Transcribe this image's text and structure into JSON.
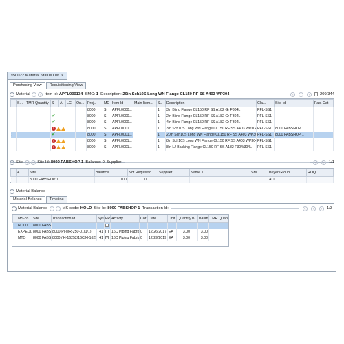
{
  "window": {
    "doc_tab": "s50022 Material Status List",
    "close": "×",
    "view_tabs": [
      "Purchasing View",
      "Requisitioning View"
    ]
  },
  "material": {
    "title": "Material",
    "item_id_label": "Item Id:",
    "item_id": "APFL000134",
    "smc_label": "SMC:",
    "smc": "1",
    "desc_label": "Description:",
    "desc": "20in Sch10S Long WN Flange CL150 RF SS A403 WP304",
    "count": "209/344",
    "columns": [
      "S.I.",
      "TMR Quantity",
      "S",
      "A",
      "LC",
      "On...",
      "Proj..",
      "MC",
      "Item Id",
      "Main Item...",
      "S..",
      "Description",
      "Cla...",
      "Site Id",
      "Fab. Cat"
    ],
    "rows": [
      {
        "tmr": "",
        "status": "",
        "proj": "8000",
        "mc": "S",
        "item": "APFL0000...",
        "main": "",
        "s": "1",
        "desc": "3in Blind Flange CL150 RF SS A182 Gr F304L",
        "cla": "PFL-SS1",
        "site": "",
        "fab": ""
      },
      {
        "tmr": "",
        "status": "check",
        "proj": "8000",
        "mc": "S",
        "item": "APFL0000...",
        "main": "",
        "s": "1",
        "desc": "2in Blind Flange CL150 RF SS A182 Gr F304L",
        "cla": "PFL-SS1",
        "site": "",
        "fab": ""
      },
      {
        "tmr": "",
        "status": "check",
        "proj": "8000",
        "mc": "S",
        "item": "APFL0000...",
        "main": "",
        "s": "1",
        "desc": "4in Blind Flange CL150 RF SS A182 Gr F304L",
        "cla": "PFL-SS1",
        "site": "",
        "fab": ""
      },
      {
        "tmr": "",
        "status": "stopwarn",
        "proj": "8000",
        "mc": "S",
        "item": "APFL0001...",
        "main": "",
        "s": "1",
        "desc": "3in Sch10S Long WN Flange CL150 RF SS A403 WP304",
        "cla": "PFL-SS1",
        "site": "8000 FABSHOP 1",
        "fab": ""
      },
      {
        "tmr": "",
        "status": "check",
        "proj": "8000",
        "mc": "S",
        "item": "APFL0001...",
        "main": "",
        "s": "1",
        "desc": "20in Sch10S Long WN Flange CL150 RF SS A403 WP304",
        "cla": "PFL-SS1",
        "site": "8000 FABSHOP 1",
        "fab": ""
      },
      {
        "tmr": "",
        "status": "stopwarn",
        "proj": "8000",
        "mc": "S",
        "item": "APFL0001...",
        "main": "",
        "s": "1",
        "desc": "8in Sch10S Long WN Flange CL150 RF SS A403 WP304",
        "cla": "PFL-SS1",
        "site": "",
        "fab": ""
      },
      {
        "tmr": "",
        "status": "stopwarn",
        "proj": "8000",
        "mc": "S",
        "item": "APFL0001...",
        "main": "",
        "s": "1",
        "desc": "8in LJ Backing Flange CL150 RF SS A182 F304/304L",
        "cla": "PFL-SS1",
        "site": "",
        "fab": ""
      }
    ]
  },
  "site": {
    "title": "Site",
    "site_id_label": "Site Id:",
    "site_id": "8000 FABSHOP 1",
    "balance_label": "Balance:",
    "balance": "0",
    "supplier_label": "Supplier:",
    "count": "1/1",
    "columns": [
      "A",
      "Site",
      "Balance",
      "Not Requisitio...",
      "Supplier",
      "Name 1",
      "SMC",
      "Buyer Group",
      "ROQ"
    ],
    "rows": [
      {
        "a": "",
        "site": "8000 FABSHOP 1",
        "balance": "0.00",
        "notreq": "0",
        "supplier": "",
        "name": "",
        "smc": "1",
        "buyer": "ALL",
        "roq": ""
      }
    ]
  },
  "mat_balance": {
    "title": "Material Balance",
    "sub_tabs": [
      "Material Balance",
      "Timeline"
    ],
    "inner_title": "Material Balance",
    "ms_code_label": "MS-code:",
    "ms_code": "HOLD",
    "site_id_label": "Site Id:",
    "site_id": "8000 FABSHOP 1",
    "trans_label": "Transaction Id:",
    "count": "1/3",
    "columns": [
      "MS-co...",
      "Site",
      "Transaction Id",
      "Sys..",
      "FR",
      "Activity",
      "Cor..",
      "Date",
      "Unit",
      "Quantity",
      "B...",
      "Balan...",
      "TMR Quantity"
    ],
    "rows": [
      {
        "ms": "HOLD",
        "site": "8000 FABS...",
        "trans": "",
        "sys": "",
        "fr": false,
        "act": "",
        "cor": "",
        "date": "",
        "unit": "",
        "qty": "",
        "b": "",
        "bal": "",
        "tmr": ""
      },
      {
        "ms": "EXPEDI...",
        "site": "8000 FABS...",
        "trans": "8000-PI-MR-250-01(1/1)",
        "sys": "41",
        "fr": false,
        "act": "16C Piping Fabric...",
        "cor": "0",
        "date": "12/26/2017",
        "unit": "EA",
        "qty": "3.00",
        "b": "",
        "bal": "3.00",
        "tmr": ""
      },
      {
        "ms": "MTO",
        "site": "8000 FABS...",
        "trans": "8000 / H-16252/16C/H-16252(90)",
        "sys": "41",
        "fr": true,
        "act": "16C Piping Fabric...",
        "cor": "0",
        "date": "12/29/2019",
        "unit": "EA",
        "qty": "3.00",
        "b": "",
        "bal": "3.00",
        "tmr": ""
      }
    ]
  }
}
